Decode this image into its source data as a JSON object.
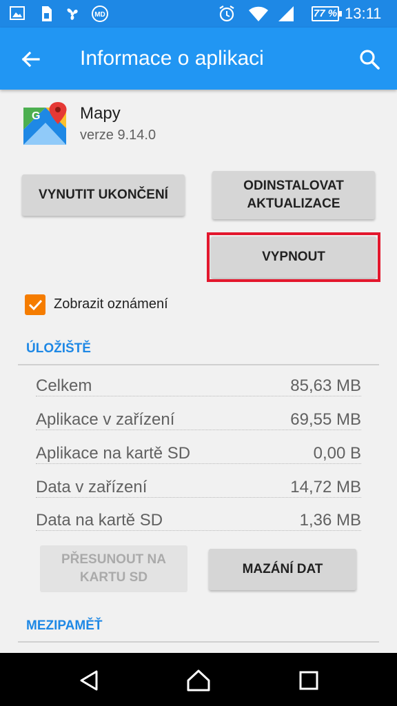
{
  "status_bar": {
    "battery": "77 %",
    "time": "13:11",
    "icons": [
      "image-icon",
      "sim-icon",
      "fan-icon",
      "md-badge-icon",
      "alarm-icon",
      "wifi-icon",
      "signal-icon",
      "battery-icon"
    ]
  },
  "app_bar": {
    "title": "Informace o aplikaci",
    "back_icon": "arrow-back-icon",
    "search_icon": "search-icon",
    "color": "#2196f3"
  },
  "app": {
    "name": "Mapy",
    "version": "verze 9.14.0",
    "icon": "google-maps-icon"
  },
  "buttons": {
    "force_stop": "VYNUTIT UKONČENÍ",
    "uninstall_updates_line1": "ODINSTALOVAT",
    "uninstall_updates_line2": "AKTUALIZACE",
    "disable": "VYPNOUT",
    "move_line1": "PŘESUNOUT NA",
    "move_line2": "KARTU SD",
    "clear_data": "MAZÁNÍ DAT"
  },
  "notifications": {
    "label": "Zobrazit oznámení",
    "checked": true,
    "accent": "#f57c00"
  },
  "storage": {
    "title": "ÚLOŽIŠTĚ",
    "rows": [
      {
        "label": "Celkem",
        "value": "85,63 MB"
      },
      {
        "label": "Aplikace v zařízení",
        "value": "69,55 MB"
      },
      {
        "label": "Aplikace na kartě SD",
        "value": "0,00 B"
      },
      {
        "label": "Data v zařízení",
        "value": "14,72 MB"
      },
      {
        "label": "Data na kartě SD",
        "value": "1,36 MB"
      }
    ]
  },
  "cache": {
    "title": "MEZIPAMĚŤ"
  },
  "highlight_color": "#e3172d",
  "nav_bar": {
    "icons": [
      "nav-back-icon",
      "nav-home-icon",
      "nav-recent-icon"
    ]
  }
}
